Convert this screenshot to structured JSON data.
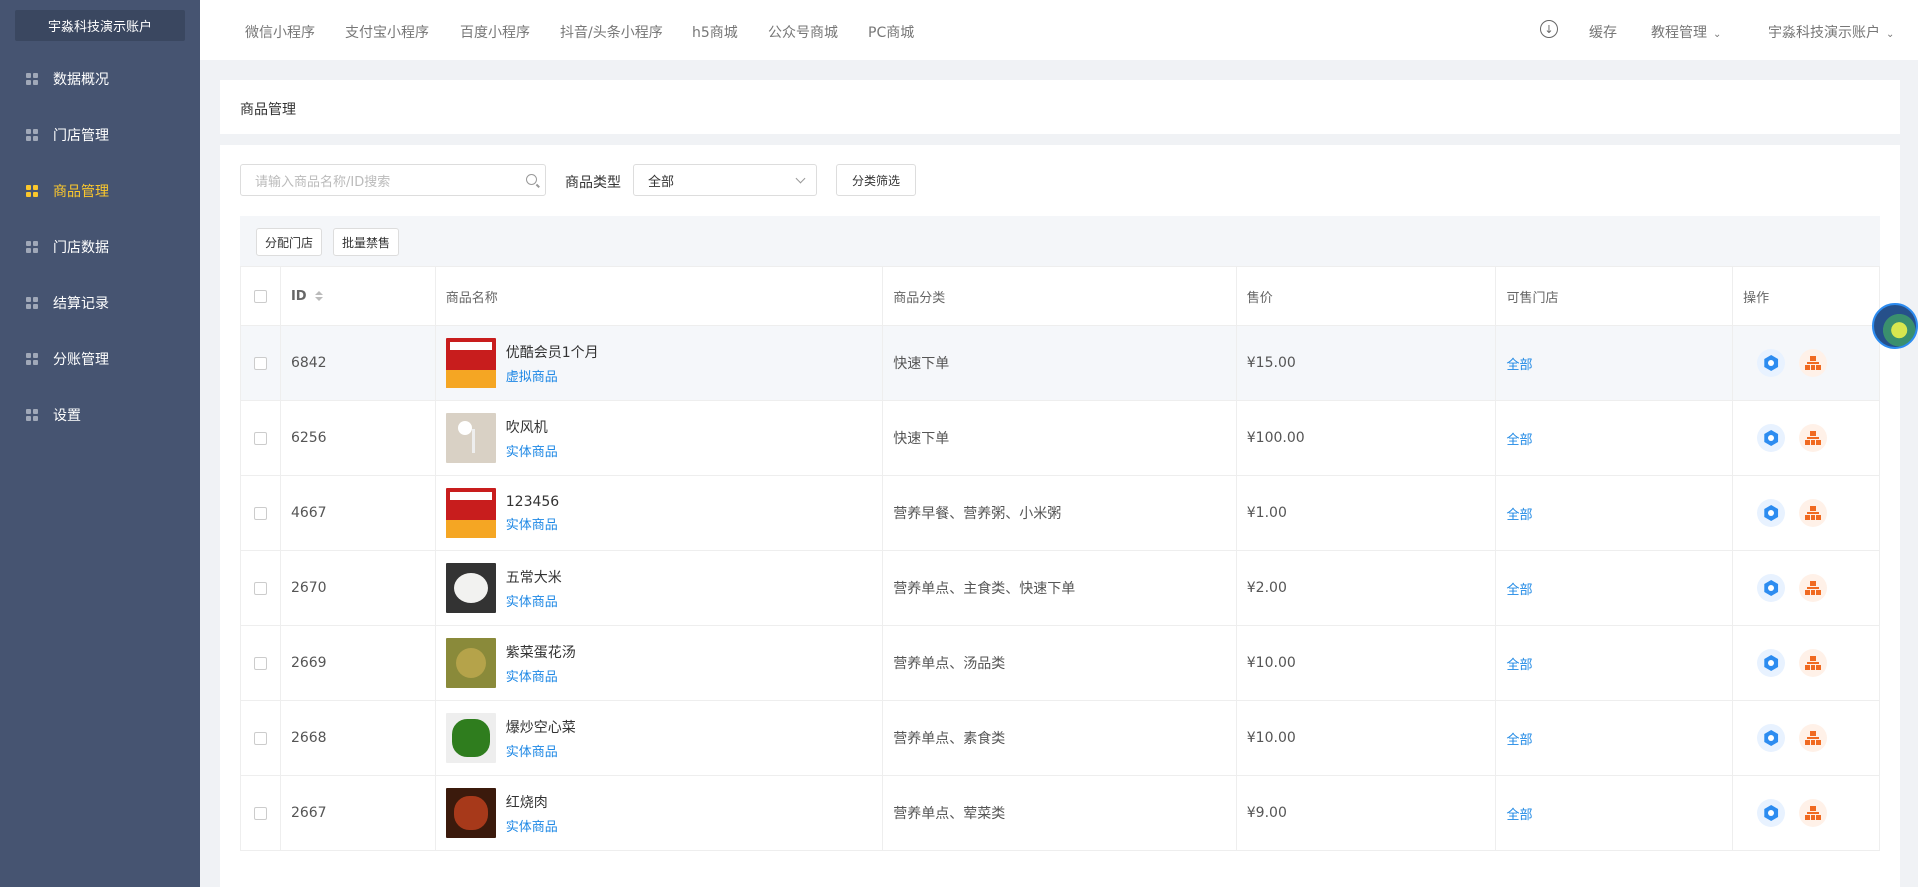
{
  "sidebar": {
    "brand": "宇淼科技演示账户",
    "items": [
      {
        "label": "数据概况"
      },
      {
        "label": "门店管理"
      },
      {
        "label": "商品管理"
      },
      {
        "label": "门店数据"
      },
      {
        "label": "结算记录"
      },
      {
        "label": "分账管理"
      },
      {
        "label": "设置"
      }
    ],
    "active_color": "#fcc82c"
  },
  "topbar": {
    "tabs": [
      {
        "label": "微信小程序"
      },
      {
        "label": "支付宝小程序"
      },
      {
        "label": "百度小程序"
      },
      {
        "label": "抖音/头条小程序"
      },
      {
        "label": "h5商城"
      },
      {
        "label": "公众号商城"
      },
      {
        "label": "PC商城"
      }
    ],
    "cache_label": "缓存",
    "tutorial_label": "教程管理",
    "account_label": "宇淼科技演示账户"
  },
  "page": {
    "title": "商品管理",
    "search_placeholder": "请输入商品名称/ID搜索",
    "type_label": "商品类型",
    "type_value": "全部",
    "filter_btn": "分类筛选",
    "assign_btn": "分配门店",
    "ban_btn": "批量禁售"
  },
  "table": {
    "headers": {
      "id": "ID",
      "name": "商品名称",
      "category": "商品分类",
      "price": "售价",
      "stores": "可售门店",
      "ops": "操作"
    },
    "rows": [
      {
        "id": "6842",
        "name": "优酷会员1个月",
        "kind": "虚拟商品",
        "category": "快速下单",
        "price": "¥15.00",
        "stores": "全部",
        "thumb": "red"
      },
      {
        "id": "6256",
        "name": "吹风机",
        "kind": "实体商品",
        "category": "快速下单",
        "price": "¥100.00",
        "stores": "全部",
        "thumb": "dryer"
      },
      {
        "id": "4667",
        "name": "123456",
        "kind": "实体商品",
        "category": "营养早餐、营养粥、小米粥",
        "price": "¥1.00",
        "stores": "全部",
        "thumb": "red"
      },
      {
        "id": "2670",
        "name": "五常大米",
        "kind": "实体商品",
        "category": "营养单点、主食类、快速下单",
        "price": "¥2.00",
        "stores": "全部",
        "thumb": "rice"
      },
      {
        "id": "2669",
        "name": "紫菜蛋花汤",
        "kind": "实体商品",
        "category": "营养单点、汤品类",
        "price": "¥10.00",
        "stores": "全部",
        "thumb": "soup"
      },
      {
        "id": "2668",
        "name": "爆炒空心菜",
        "kind": "实体商品",
        "category": "营养单点、素食类",
        "price": "¥10.00",
        "stores": "全部",
        "thumb": "veg"
      },
      {
        "id": "2667",
        "name": "红烧肉",
        "kind": "实体商品",
        "category": "营养单点、荤菜类",
        "price": "¥9.00",
        "stores": "全部",
        "thumb": "pork"
      }
    ]
  }
}
